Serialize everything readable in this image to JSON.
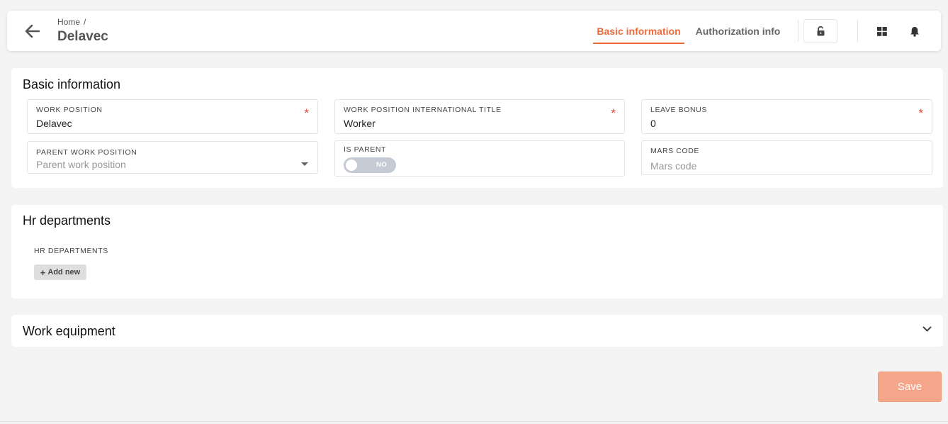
{
  "header": {
    "breadcrumb": {
      "home": "Home",
      "separator": "/"
    },
    "title": "Delavec",
    "tabs": [
      {
        "label": "Basic information",
        "active": true
      },
      {
        "label": "Authorization info",
        "active": false
      }
    ],
    "icons": {
      "back": "arrow-left-icon",
      "lock": "unlock-icon",
      "apps": "grid-icon",
      "notifications": "bell-icon"
    }
  },
  "colors": {
    "accent": "#ee6a3a",
    "required": "#e0443a",
    "save_bg": "#f4a58a",
    "toggle_off": "#c4cbd4"
  },
  "basic_info": {
    "title": "Basic information",
    "fields": {
      "work_position": {
        "label": "WORK POSITION",
        "value": "Delavec",
        "required": "*"
      },
      "international_title": {
        "label": "WORK POSITION INTERNATIONAL TITLE",
        "value": "Worker",
        "required": "*"
      },
      "leave_bonus": {
        "label": "LEAVE BONUS",
        "value": "0",
        "required": "*"
      },
      "parent_work_position": {
        "label": "PARENT WORK POSITION",
        "placeholder": "Parent work position"
      },
      "is_parent": {
        "label": "IS PARENT",
        "toggle_text": "NO",
        "on": false
      },
      "mars_code": {
        "label": "MARS CODE",
        "placeholder": "Mars code"
      }
    }
  },
  "hr_departments": {
    "title": "Hr departments",
    "sub_label": "HR DEPARTMENTS",
    "add_label": "Add new"
  },
  "work_equipment": {
    "title": "Work equipment",
    "collapsed": true
  },
  "actions": {
    "save_label": "Save"
  }
}
